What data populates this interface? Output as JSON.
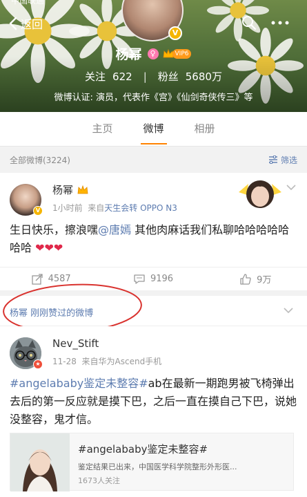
{
  "header": {
    "status_text": "中国联通",
    "back_label": "返回",
    "profile_name": "杨幂",
    "female_symbol": "♀",
    "vip_label": "VIP6",
    "verified_symbol": "V",
    "following_label": "关注",
    "following_count": "622",
    "divider": "|",
    "followers_label": "粉丝",
    "followers_count": "5680万",
    "verification_text": "微博认证: 演员，代表作《宫》《仙剑奇侠传三》等",
    "icons": [
      "chevron-left-icon",
      "search-icon",
      "more-icon"
    ]
  },
  "tabs": [
    {
      "label": "主页",
      "active": false
    },
    {
      "label": "微博",
      "active": true
    },
    {
      "label": "相册",
      "active": false
    }
  ],
  "filter_bar": {
    "count_label": "全部微博(3224)",
    "filter_label": "筛选"
  },
  "post1": {
    "author": "杨幂",
    "time": "1小时前",
    "source_prefix": "来自",
    "source": "天生会转 OPPO N3",
    "body_start": "生日快乐，擦浪嘿",
    "mention": "@唐嫣",
    "body_end": " 其他肉麻话我们私聊哈哈哈哈哈哈哈",
    "emoji": "❤❤❤",
    "actions": {
      "repost_count": "4587",
      "comment_count": "9196",
      "like_count": "9万"
    }
  },
  "liked_bar": {
    "name": "杨幂",
    "text": "刚刚赞过的微博"
  },
  "post2": {
    "author": "Nev_Stift",
    "date": "11-28",
    "source": "来自华为Ascend手机",
    "topic": "#angelababy鉴定未整容#",
    "body": "ab在最新一期跑男被飞椅弹出去后的第一反应就是摸下巴，之后一直在摸自己下巴，说她没整容，鬼才信。",
    "card": {
      "title": "#angelababy鉴定未整容#",
      "desc": "鉴定结果已出来，中国医学科学院整形外形医...",
      "followers": "1673人关注"
    }
  },
  "colors": {
    "accent": "#ff8200",
    "link": "#5d7cb0",
    "annotation": "#d9322e"
  }
}
